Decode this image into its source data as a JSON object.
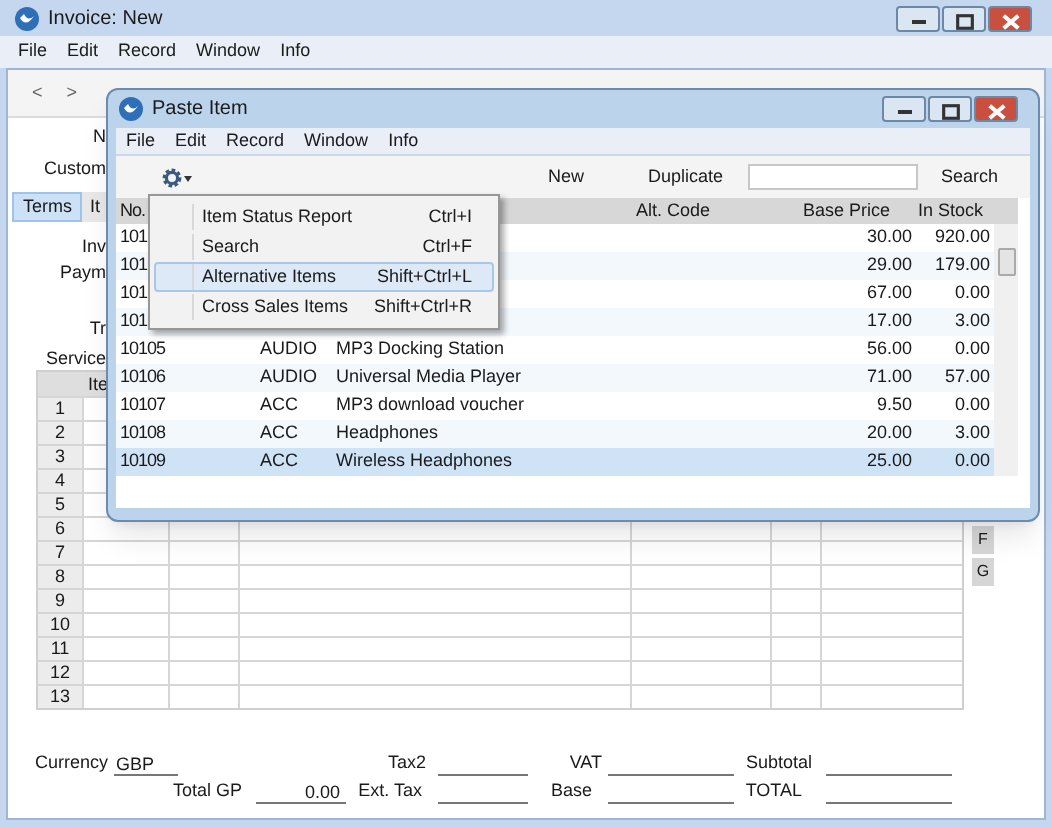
{
  "invoice_window": {
    "title": "Invoice: New",
    "menu": [
      "File",
      "Edit",
      "Record",
      "Window",
      "Info"
    ],
    "nav": [
      "<",
      ">"
    ],
    "field_labels": [
      "N",
      "Custom"
    ],
    "tabs": [
      {
        "label": "Terms",
        "selected": true
      },
      {
        "label": "It",
        "selected": false
      }
    ],
    "term_labels": [
      "Inv",
      "Paym",
      "Tr",
      "Service"
    ],
    "grid": {
      "column_1": "Ite",
      "row_numbers": [
        "1",
        "2",
        "3",
        "4",
        "5",
        "6",
        "7",
        "8",
        "9",
        "10",
        "11",
        "12",
        "13"
      ]
    },
    "side_tabs": [
      "F",
      "G"
    ],
    "footer": {
      "currency_label": "Currency",
      "currency": "GBP",
      "tax2_label": "Tax2",
      "vat_label": "VAT",
      "subtotal_label": "Subtotal",
      "total_gp_label": "Total GP",
      "total_gp": "0.00",
      "ext_tax_label": "Ext. Tax",
      "base_label": "Base",
      "total_label": "TOTAL"
    }
  },
  "paste_window": {
    "title": "Paste Item",
    "menu": [
      "File",
      "Edit",
      "Record",
      "Window",
      "Info"
    ],
    "toolbar": {
      "new": "New",
      "duplicate": "Duplicate",
      "search": "Search"
    },
    "columns": {
      "number": "No.",
      "alt_code": "Alt. Code",
      "base_price": "Base Price",
      "in_stock": "In Stock"
    },
    "rows": [
      {
        "number": "101",
        "base_price": "30.00",
        "in_stock": "920.00",
        "selected": false
      },
      {
        "number": "101",
        "base_price": "29.00",
        "in_stock": "179.00",
        "selected": false
      },
      {
        "number": "101",
        "base_price": "67.00",
        "in_stock": "0.00",
        "selected": false
      },
      {
        "number": "101",
        "base_price": "17.00",
        "in_stock": "3.00",
        "selected": false
      },
      {
        "number": "10105",
        "group": "AUDIO",
        "name": "MP3 Docking Station",
        "base_price": "56.00",
        "in_stock": "0.00",
        "selected": false
      },
      {
        "number": "10106",
        "group": "AUDIO",
        "name": "Universal Media Player",
        "base_price": "71.00",
        "in_stock": "57.00",
        "selected": false
      },
      {
        "number": "10107",
        "group": "ACC",
        "name": "MP3 download voucher",
        "base_price": "9.50",
        "in_stock": "0.00",
        "selected": false
      },
      {
        "number": "10108",
        "group": "ACC",
        "name": "Headphones",
        "base_price": "20.00",
        "in_stock": "3.00",
        "selected": false
      },
      {
        "number": "10109",
        "group": "ACC",
        "name": "Wireless Headphones",
        "base_price": "25.00",
        "in_stock": "0.00",
        "selected": true
      }
    ],
    "context_menu": [
      {
        "label": "Item Status Report",
        "shortcut": "Ctrl+I",
        "selected": false
      },
      {
        "label": "Search",
        "shortcut": "Ctrl+F",
        "selected": false
      },
      {
        "label": "Alternative Items",
        "shortcut": "Shift+Ctrl+L",
        "selected": true
      },
      {
        "label": "Cross Sales Items",
        "shortcut": "Shift+Ctrl+R",
        "selected": false
      }
    ]
  }
}
